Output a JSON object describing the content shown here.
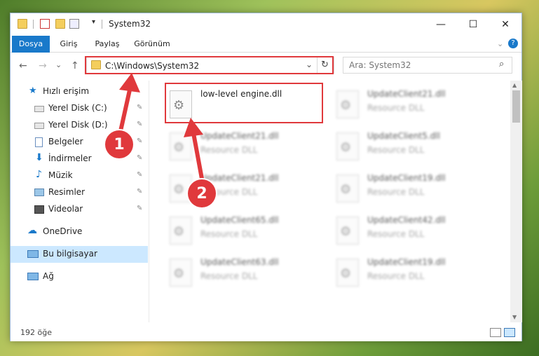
{
  "window": {
    "title": "System32",
    "controls": {
      "minimize": "—",
      "maximize": "☐",
      "close": "✕"
    }
  },
  "ribbon": {
    "tabs": [
      {
        "label": "Dosya",
        "active": true
      },
      {
        "label": "Giriş"
      },
      {
        "label": "Paylaş"
      },
      {
        "label": "Görünüm"
      }
    ],
    "help_icon": "?"
  },
  "nav": {
    "back": "←",
    "forward": "→",
    "recent": "⌄",
    "up": "↑",
    "address": "C:\\Windows\\System32",
    "refresh": "↻",
    "search_placeholder": "Ara: System32",
    "search_glyph": "⌕"
  },
  "sidebar": {
    "quick_access": "Hızlı erişim",
    "items": [
      {
        "label": "Yerel Disk (C:)",
        "icon": "drive-icon"
      },
      {
        "label": "Yerel Disk (D:)",
        "icon": "drive-icon"
      },
      {
        "label": "Belgeler",
        "icon": "documents-icon"
      },
      {
        "label": "İndirmeler",
        "icon": "downloads-icon"
      },
      {
        "label": "Müzik",
        "icon": "music-icon"
      },
      {
        "label": "Resimler",
        "icon": "pictures-icon"
      },
      {
        "label": "Videolar",
        "icon": "videos-icon"
      }
    ],
    "onedrive": "OneDrive",
    "this_pc": "Bu bilgisayar",
    "network": "Ağ",
    "pin_glyph": "📌"
  },
  "files": [
    {
      "name": "low-level engine.dll",
      "type": ""
    },
    {
      "name": "UpdateClient21.dll",
      "type": "Resource DLL"
    },
    {
      "name": "UpdateClient21.dll",
      "type": "Resource DLL"
    },
    {
      "name": "UpdateClient5.dll",
      "type": "Resource DLL"
    },
    {
      "name": "UpdateClient21.dll",
      "type": "Resource DLL"
    },
    {
      "name": "UpdateClient19.dll",
      "type": "Resource DLL"
    },
    {
      "name": "UpdateClient65.dll",
      "type": "Resource DLL"
    },
    {
      "name": "UpdateClient42.dll",
      "type": "Resource DLL"
    },
    {
      "name": "UpdateClient63.dll",
      "type": "Resource DLL"
    },
    {
      "name": "UpdateClient19.dll",
      "type": "Resource DLL"
    }
  ],
  "status": {
    "item_count": "192 öğe"
  },
  "annotations": {
    "step1": "1",
    "step2": "2",
    "color": "#e0393c"
  },
  "colors": {
    "accent": "#1979ca",
    "selection": "#cce8ff"
  }
}
